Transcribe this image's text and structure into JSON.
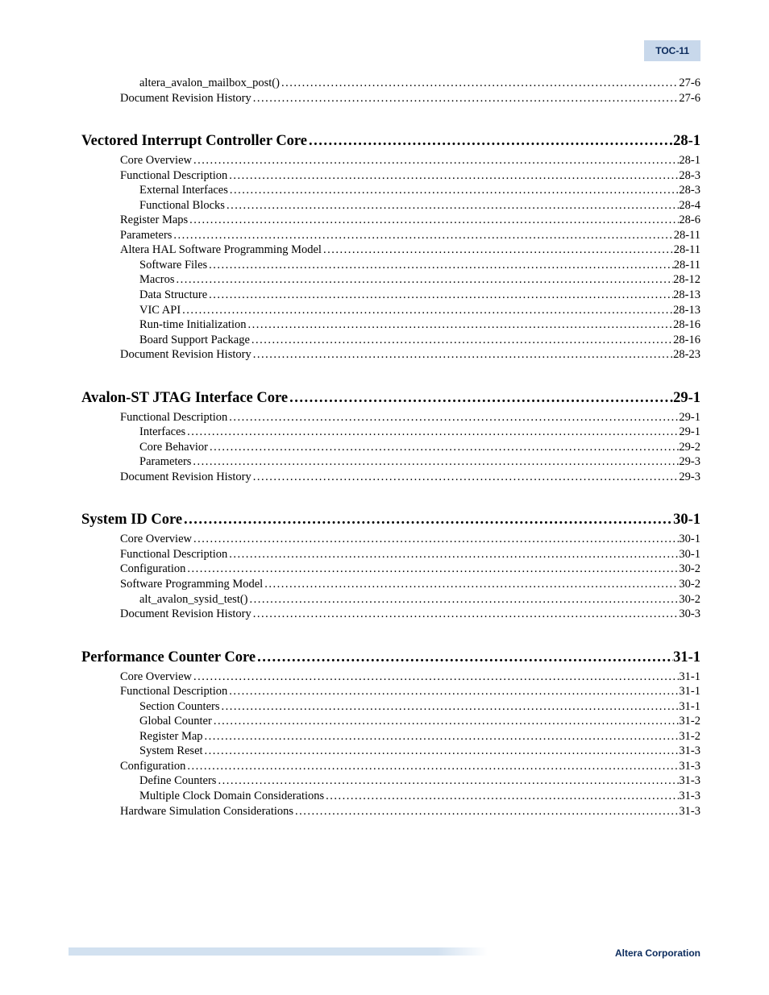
{
  "header": {
    "badge": "TOC-11"
  },
  "intro_lines": [
    {
      "indent": 3,
      "title": "altera_avalon_mailbox_post()",
      "page": "27-6"
    },
    {
      "indent": 2,
      "title": "Document Revision History",
      "page": "27-6"
    }
  ],
  "chapters": [
    {
      "title": "Vectored Interrupt Controller Core",
      "page": "28-1",
      "lines": [
        {
          "indent": 2,
          "title": "Core Overview",
          "page": "28-1"
        },
        {
          "indent": 2,
          "title": "Functional Description",
          "page": "28-3"
        },
        {
          "indent": 3,
          "title": "External Interfaces",
          "page": "28-3"
        },
        {
          "indent": 3,
          "title": "Functional Blocks",
          "page": "28-4"
        },
        {
          "indent": 2,
          "title": "Register Maps",
          "page": "28-6"
        },
        {
          "indent": 2,
          "title": "Parameters",
          "page": "28-11"
        },
        {
          "indent": 2,
          "title": "Altera HAL Software Programming Model",
          "page": "28-11"
        },
        {
          "indent": 3,
          "title": "Software Files",
          "page": "28-11"
        },
        {
          "indent": 3,
          "title": "Macros",
          "page": "28-12"
        },
        {
          "indent": 3,
          "title": "Data Structure",
          "page": "28-13"
        },
        {
          "indent": 3,
          "title": "VIC API",
          "page": "28-13"
        },
        {
          "indent": 3,
          "title": "Run-time Initialization",
          "page": "28-16"
        },
        {
          "indent": 3,
          "title": "Board Support Package",
          "page": "28-16"
        },
        {
          "indent": 2,
          "title": "Document Revision History",
          "page": "28-23"
        }
      ]
    },
    {
      "title": "Avalon-ST JTAG Interface Core",
      "page": "29-1",
      "lines": [
        {
          "indent": 2,
          "title": "Functional Description",
          "page": "29-1"
        },
        {
          "indent": 3,
          "title": "Interfaces",
          "page": "29-1"
        },
        {
          "indent": 3,
          "title": "Core Behavior",
          "page": "29-2"
        },
        {
          "indent": 3,
          "title": "Parameters",
          "page": "29-3"
        },
        {
          "indent": 2,
          "title": "Document Revision History",
          "page": "29-3"
        }
      ]
    },
    {
      "title": "System ID Core",
      "page": "30-1",
      "lines": [
        {
          "indent": 2,
          "title": "Core Overview",
          "page": "30-1"
        },
        {
          "indent": 2,
          "title": "Functional Description",
          "page": "30-1"
        },
        {
          "indent": 2,
          "title": "Configuration",
          "page": "30-2"
        },
        {
          "indent": 2,
          "title": "Software Programming Model",
          "page": "30-2"
        },
        {
          "indent": 3,
          "title": "alt_avalon_sysid_test()",
          "page": "30-2"
        },
        {
          "indent": 2,
          "title": "Document Revision History",
          "page": "30-3"
        }
      ]
    },
    {
      "title": "Performance Counter Core",
      "page": "31-1",
      "lines": [
        {
          "indent": 2,
          "title": "Core Overview",
          "page": "31-1"
        },
        {
          "indent": 2,
          "title": "Functional Description",
          "page": "31-1"
        },
        {
          "indent": 3,
          "title": "Section Counters",
          "page": "31-1"
        },
        {
          "indent": 3,
          "title": "Global Counter",
          "page": "31-2"
        },
        {
          "indent": 3,
          "title": "Register Map",
          "page": "31-2"
        },
        {
          "indent": 3,
          "title": "System Reset",
          "page": "31-3"
        },
        {
          "indent": 2,
          "title": "Configuration",
          "page": "31-3"
        },
        {
          "indent": 3,
          "title": "Define Counters",
          "page": "31-3"
        },
        {
          "indent": 3,
          "title": "Multiple Clock Domain Considerations",
          "page": "31-3"
        },
        {
          "indent": 2,
          "title": "Hardware Simulation Considerations",
          "page": "31-3"
        }
      ]
    }
  ],
  "footer": {
    "text": "Altera Corporation"
  }
}
